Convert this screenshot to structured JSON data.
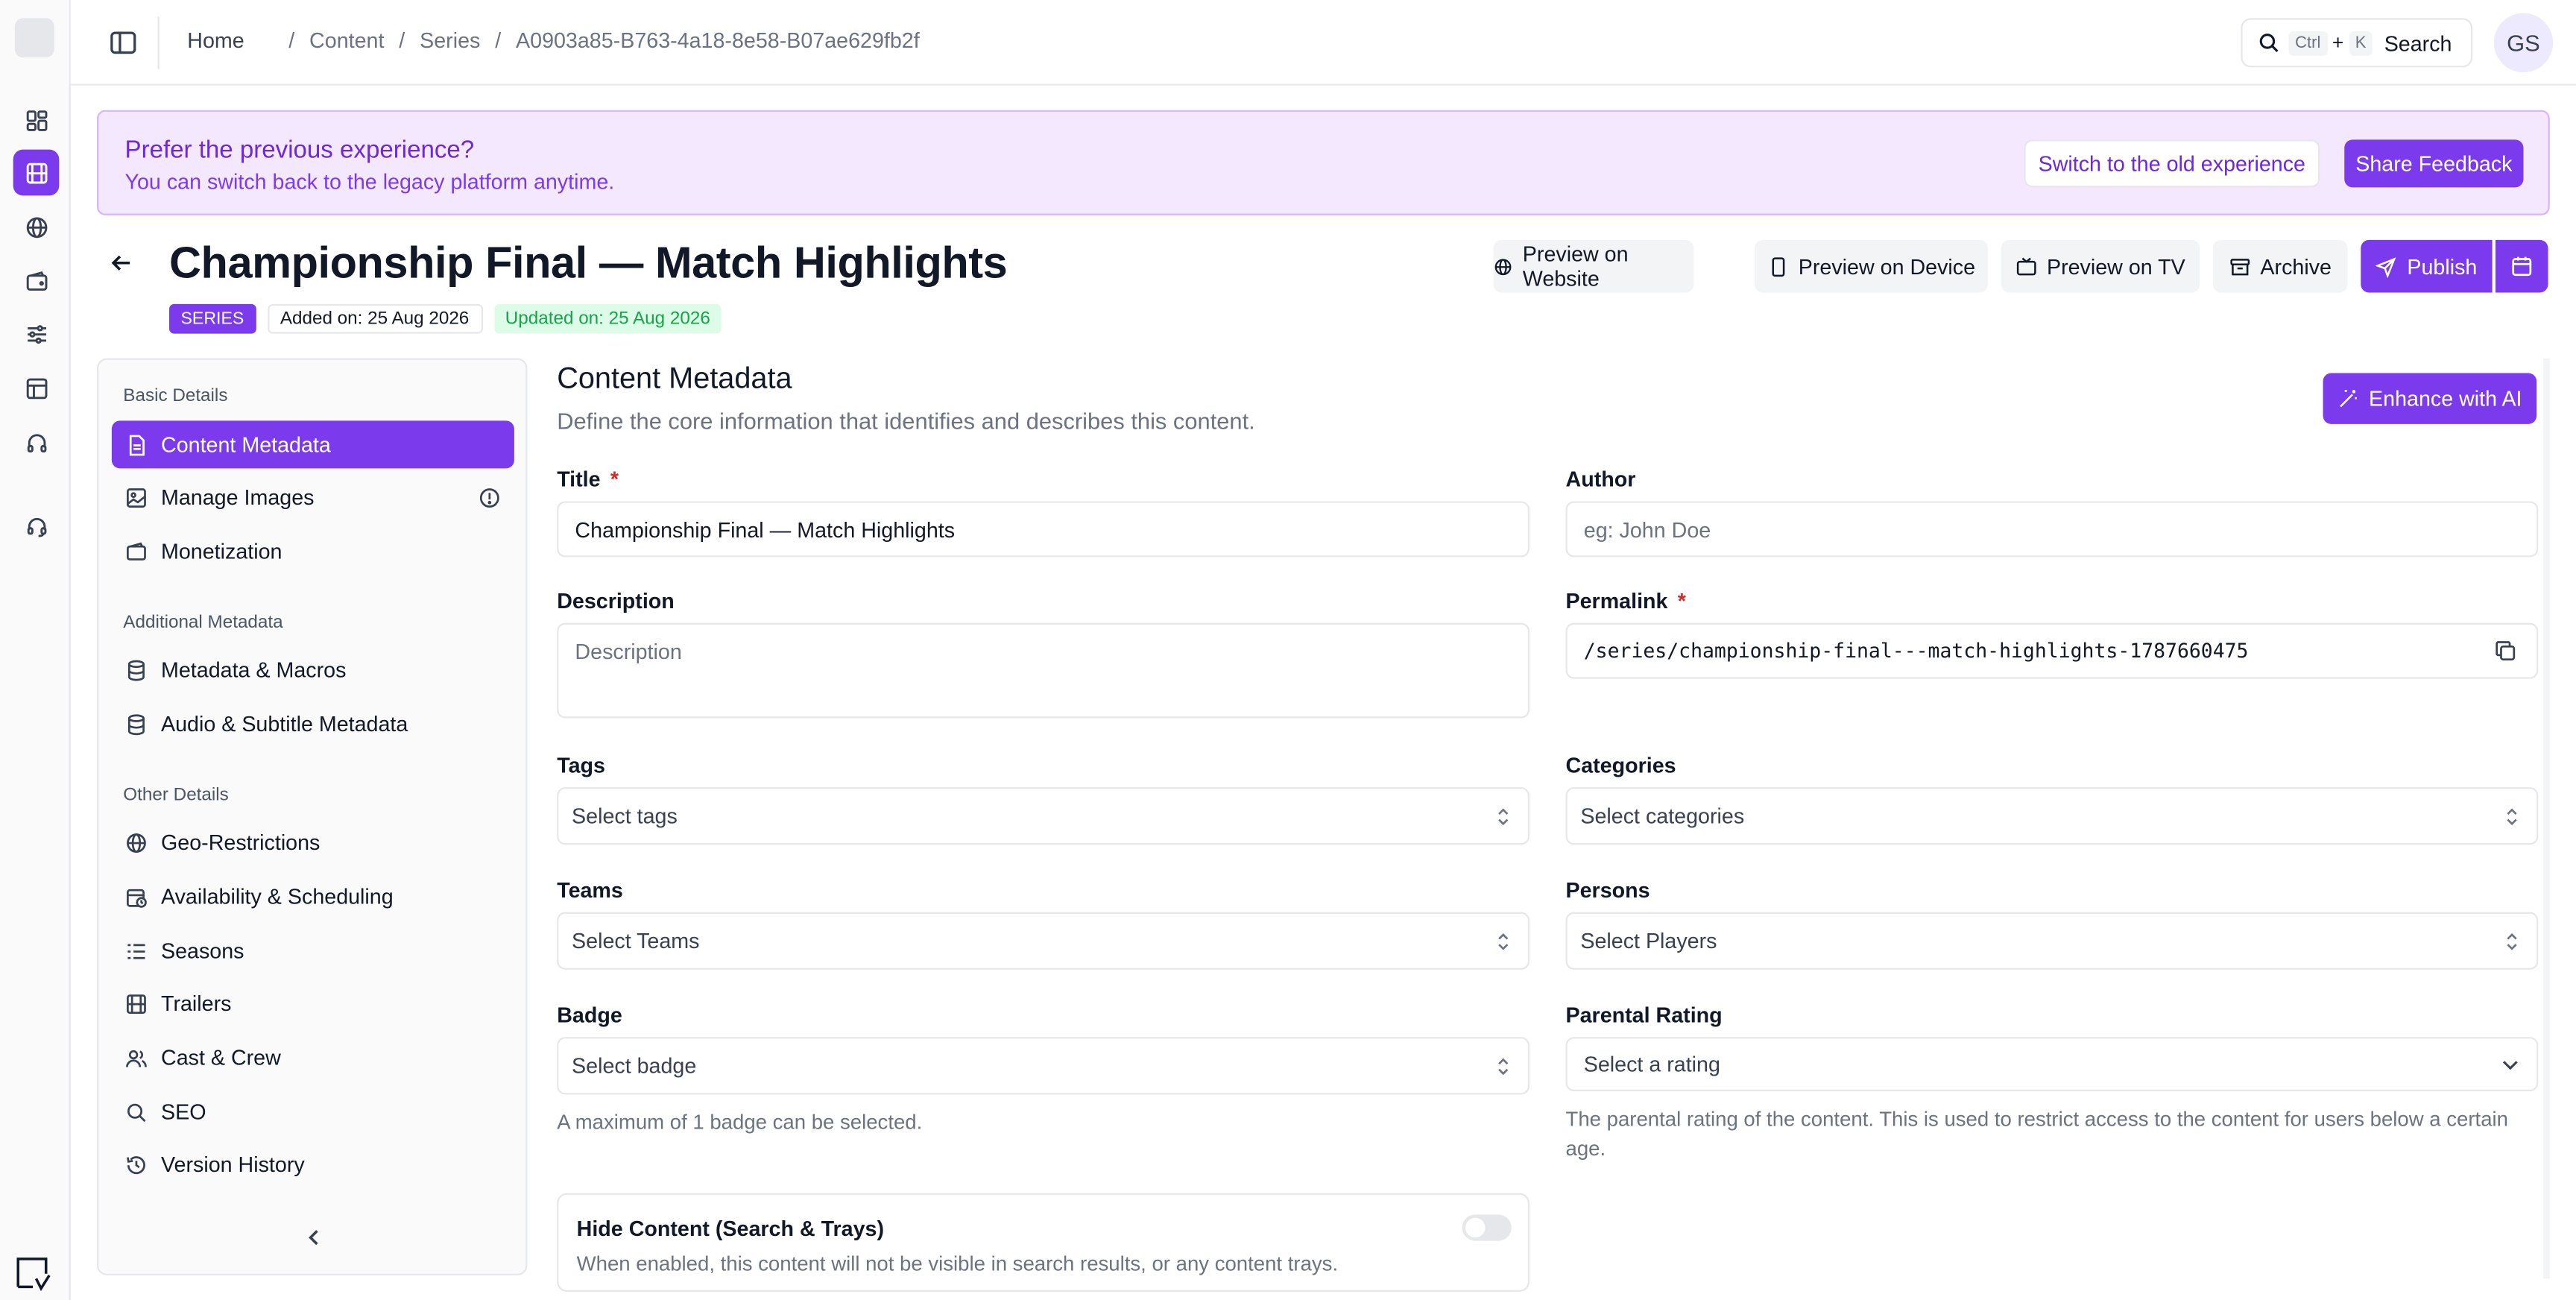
{
  "breadcrumb": {
    "home": "Home",
    "items": [
      "Content",
      "Series",
      "A0903a85-B763-4a18-8e58-B07ae629fb2f"
    ],
    "separator": "/"
  },
  "search": {
    "k1": "Ctrl",
    "plus": "+",
    "k2": "K",
    "label": "Search"
  },
  "avatar": {
    "initials": "GS"
  },
  "banner": {
    "title": "Prefer the previous experience?",
    "subtitle": "You can switch back to the legacy platform anytime.",
    "switch_label": "Switch to the old experience",
    "feedback_label": "Share Feedback"
  },
  "header": {
    "title": "Championship Final — Match Highlights",
    "type_badge": "SERIES",
    "added": "Added on: 25 Aug 2026",
    "updated": "Updated on: 25 Aug 2026"
  },
  "actions": {
    "preview_website": "Preview on Website",
    "preview_device": "Preview on Device",
    "preview_tv": "Preview on TV",
    "archive": "Archive",
    "publish": "Publish"
  },
  "nav": {
    "basic_title": "Basic Details",
    "basic": [
      "Content Metadata",
      "Manage Images",
      "Monetization"
    ],
    "additional_title": "Additional Metadata",
    "additional": [
      "Metadata & Macros",
      "Audio & Subtitle Metadata"
    ],
    "other_title": "Other Details",
    "other": [
      "Geo-Restrictions",
      "Availability & Scheduling",
      "Seasons",
      "Trailers",
      "Cast & Crew",
      "SEO",
      "Version History"
    ]
  },
  "content": {
    "title": "Content Metadata",
    "subtitle": "Define the core information that identifies and describes this content.",
    "enhance_label": "Enhance with AI"
  },
  "form": {
    "title_label": "Title",
    "title_value": "Championship Final — Match Highlights",
    "author_label": "Author",
    "author_placeholder": "eg: John Doe",
    "description_label": "Description",
    "description_placeholder": "Description",
    "permalink_label": "Permalink",
    "permalink_value": "/series/championship-final---match-highlights-1787660475",
    "tags_label": "Tags",
    "tags_placeholder": "Select tags",
    "categories_label": "Categories",
    "categories_placeholder": "Select categories",
    "teams_label": "Teams",
    "teams_placeholder": "Select Teams",
    "persons_label": "Persons",
    "persons_placeholder": "Select Players",
    "badge_label": "Badge",
    "badge_placeholder": "Select badge",
    "badge_help": "A maximum of 1 badge can be selected.",
    "rating_label": "Parental Rating",
    "rating_placeholder": "Select a rating",
    "rating_help": "The parental rating of the content. This is used to restrict access to the content for users below a certain age.",
    "required_mark": "*"
  },
  "hide_content": {
    "title": "Hide Content (Search & Trays)",
    "description": "When enabled, this content will not be visible in search results, or any content trays.",
    "enabled": false
  },
  "colors": {
    "accent": "#7c3aed",
    "banner_bg": "#f3e8ff",
    "success": "#16a34a",
    "danger": "#dc2626"
  }
}
